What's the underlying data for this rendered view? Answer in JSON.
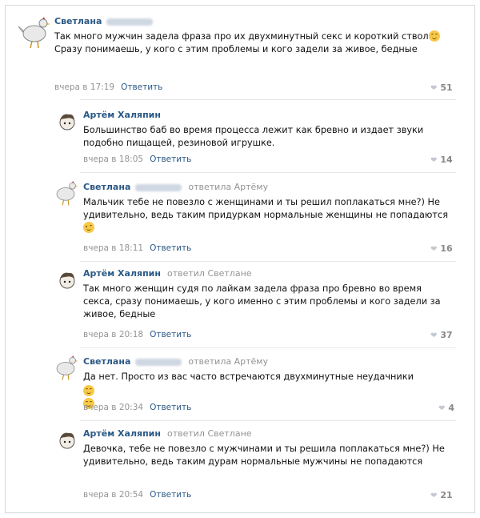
{
  "comments": [
    {
      "author": "Светлана",
      "reply_to": "",
      "text": "Так много мужчин задела фраза про их двухминутный секс и короткий ствол",
      "text2": " Сразу понимаешь, у кого с этим проблемы и кого задели за живое, бедные",
      "time": "вчера в 17:19",
      "reply_label": "Ответить",
      "likes": "51"
    },
    {
      "author": "Артём Халяпин",
      "reply_to": "",
      "text": "Большинство баб во время процесса лежит как бревно и издает звуки подобно пищащей, резиновой игрушке.",
      "time": "вчера в 18:05",
      "reply_label": "Ответить",
      "likes": "14"
    },
    {
      "author": "Светлана",
      "reply_to": "ответила Артёму",
      "text": "Мальчик тебе не повезло с женщинами и ты решил поплакаться мне?) Не удивительно, ведь таким придуркам нормальные женщины не попадаются",
      "time": "вчера в 18:11",
      "reply_label": "Ответить",
      "likes": "16"
    },
    {
      "author": "Артём Халяпин",
      "reply_to": "ответил Светлане",
      "text": "Так много женщин судя по лайкам задела фраза про бревно во время секса, сразу понимаешь, у кого именно с этим проблемы и кого задели за живое, бедные",
      "time": "вчера в 20:18",
      "reply_label": "Ответить",
      "likes": "37"
    },
    {
      "author": "Светлана",
      "reply_to": "ответила Артёму",
      "text": "Да нет. Просто из вас часто встречаются двухминутные неудачники",
      "time": "вчера в 20:34",
      "reply_label": "Ответить",
      "likes": "4"
    },
    {
      "author": "Артём Халяпин",
      "reply_to": "ответил Светлане",
      "text": "Девочка, тебе не повезло с мужчинами и ты решила поплакаться мне?) Не удивительно, ведь таким дурам нормальные мужчины не попадаются",
      "time": "вчера в 20:54",
      "reply_label": "Ответить",
      "likes": "21"
    }
  ],
  "icons": {
    "heart": "heart-icon",
    "avatar_svetlana": "chicken-avatar",
    "avatar_artem": "cartoon-avatar",
    "emoji_smile": "smile-emoji",
    "emoji_wink": "wink-emoji"
  },
  "colors": {
    "link": "#2a5885",
    "muted": "#939393",
    "divider": "#e4e7eb"
  }
}
